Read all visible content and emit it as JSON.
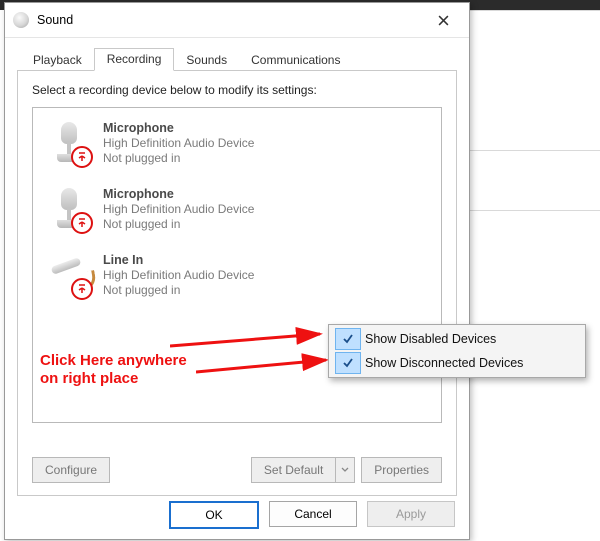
{
  "window": {
    "title": "Sound",
    "close_icon": "close-icon"
  },
  "tabs": [
    {
      "id": "playback",
      "label": "Playback"
    },
    {
      "id": "recording",
      "label": "Recording"
    },
    {
      "id": "sounds",
      "label": "Sounds"
    },
    {
      "id": "communications",
      "label": "Communications"
    }
  ],
  "active_tab": "recording",
  "recording": {
    "instruction": "Select a recording device below to modify its settings:",
    "devices": [
      {
        "icon": "microphone",
        "name": "Microphone",
        "driver": "High Definition Audio Device",
        "status": "Not plugged in",
        "badge": "unplugged"
      },
      {
        "icon": "microphone",
        "name": "Microphone",
        "driver": "High Definition Audio Device",
        "status": "Not plugged in",
        "badge": "unplugged"
      },
      {
        "icon": "line-in",
        "name": "Line In",
        "driver": "High Definition Audio Device",
        "status": "Not plugged in",
        "badge": "unplugged"
      }
    ],
    "buttons": {
      "configure": "Configure",
      "set_default": "Set Default",
      "properties": "Properties"
    }
  },
  "dialog_buttons": {
    "ok": "OK",
    "cancel": "Cancel",
    "apply": "Apply"
  },
  "context_menu": {
    "items": [
      {
        "label": "Show Disabled Devices",
        "checked": true
      },
      {
        "label": "Show Disconnected Devices",
        "checked": true
      }
    ]
  },
  "annotation": {
    "line1": "Click Here anywhere",
    "line2": "on right place"
  }
}
